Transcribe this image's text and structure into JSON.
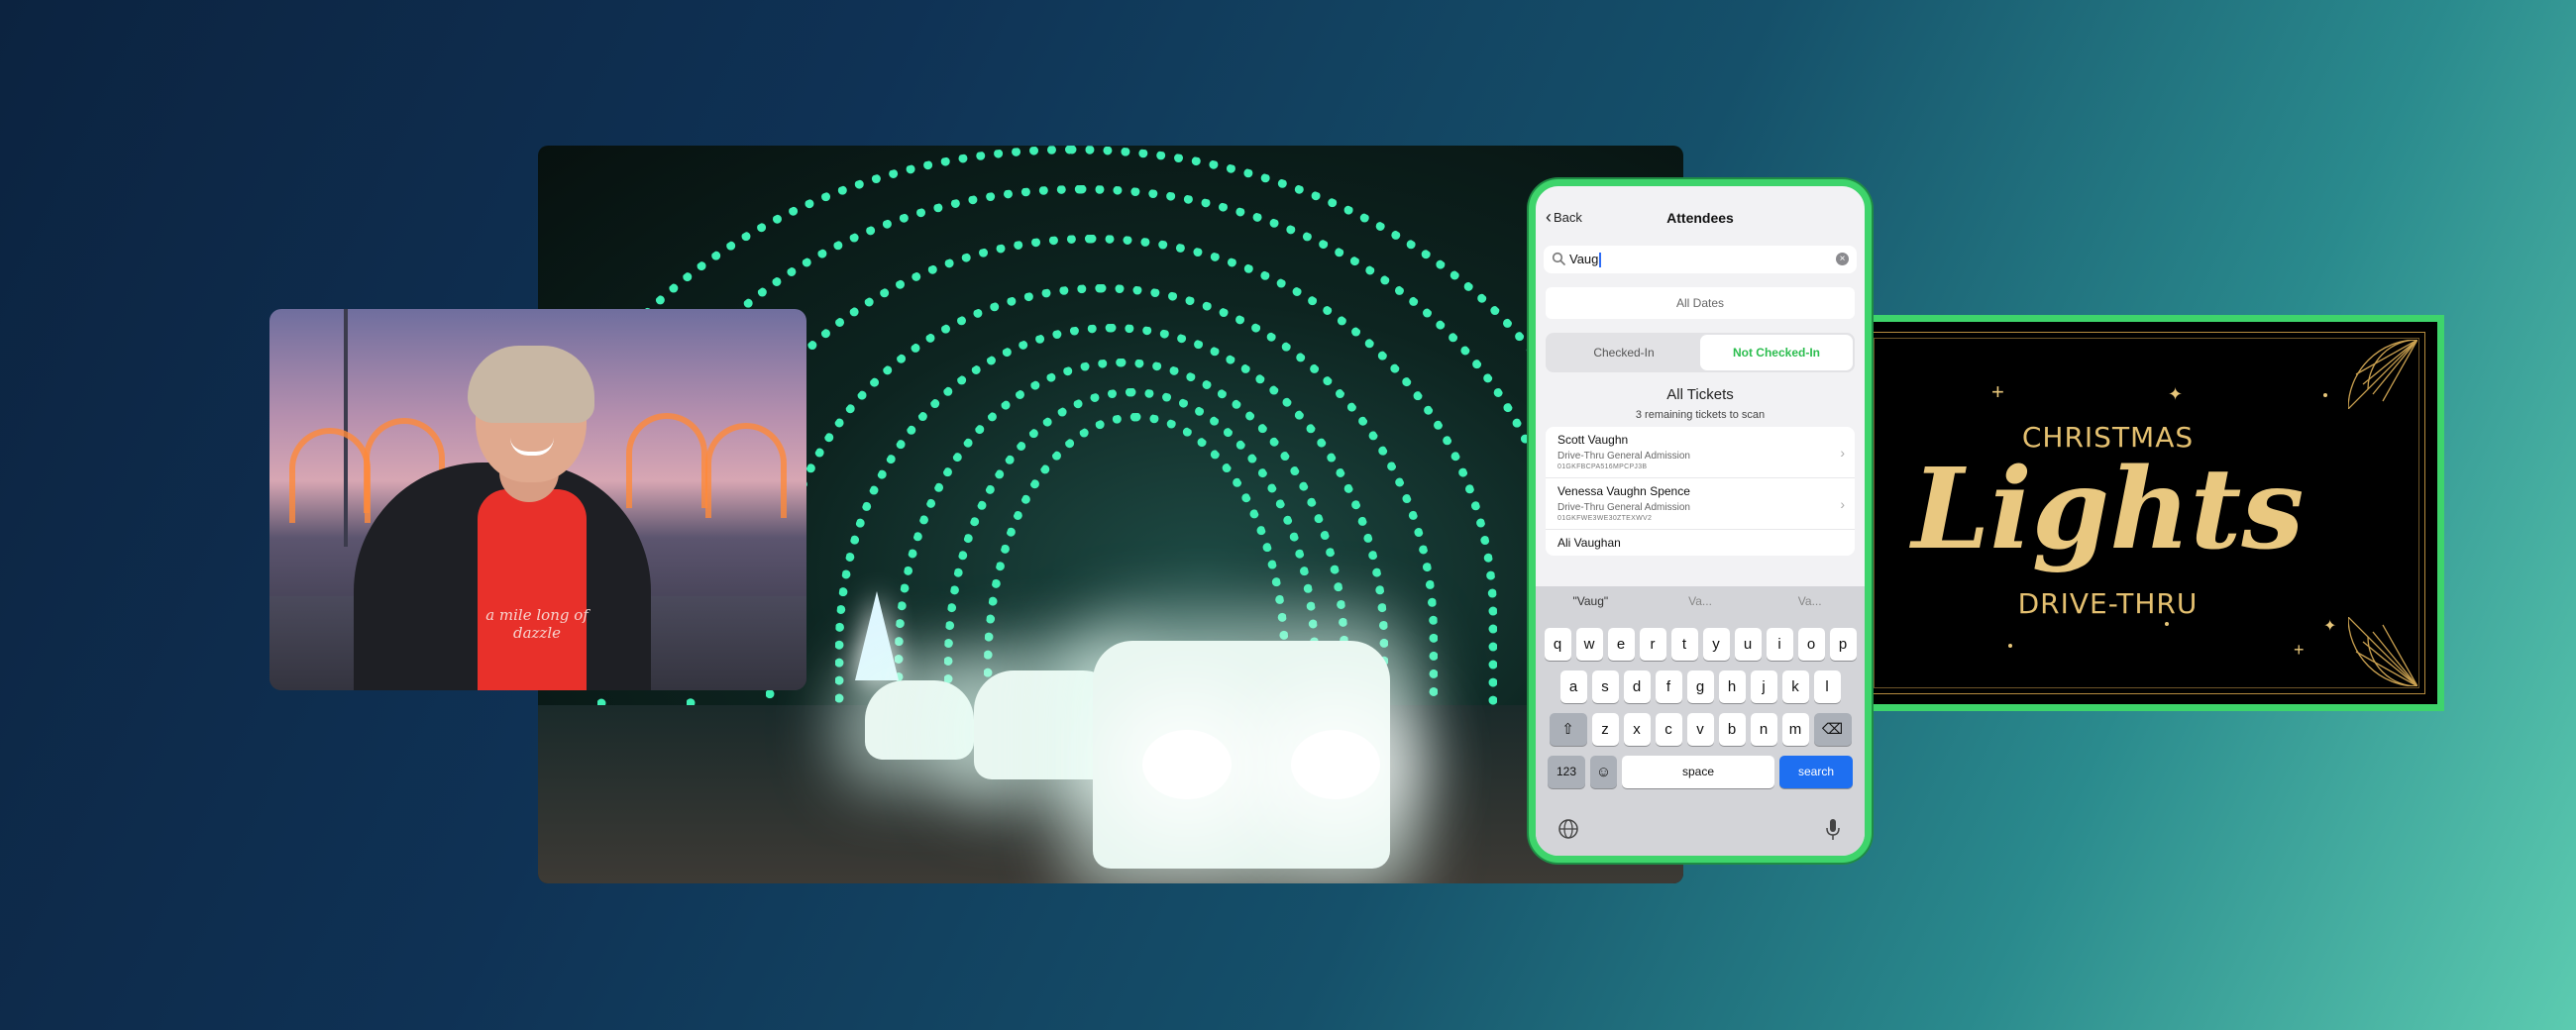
{
  "photo_left": {
    "shirt_text": "a mile long of dazzle"
  },
  "phone": {
    "nav": {
      "back_label": "Back",
      "title": "Attendees"
    },
    "search": {
      "value": "Vaug"
    },
    "dates_filter": "All Dates",
    "segments": {
      "checked_in": "Checked-In",
      "not_checked_in": "Not Checked-In"
    },
    "tickets_title": "All Tickets",
    "tickets_subtitle": "3 remaining tickets to scan",
    "attendees": [
      {
        "name": "Scott Vaughn",
        "type": "Drive-Thru General Admission",
        "code": "01GKFBCPA516MPCPJ3B"
      },
      {
        "name": "Venessa Vaughn Spence",
        "type": "Drive-Thru General Admission",
        "code": "01GKFWE3WE30ZTEXWV2"
      },
      {
        "name": "Ali Vaughan",
        "type": "",
        "code": ""
      }
    ],
    "keyboard": {
      "suggestions": [
        "\"Vaug\"",
        "Va...",
        "Va..."
      ],
      "row1": [
        "q",
        "w",
        "e",
        "r",
        "t",
        "y",
        "u",
        "i",
        "o",
        "p"
      ],
      "row2": [
        "a",
        "s",
        "d",
        "f",
        "g",
        "h",
        "j",
        "k",
        "l"
      ],
      "row3": [
        "z",
        "x",
        "c",
        "v",
        "b",
        "n",
        "m"
      ],
      "num_label": "123",
      "space_label": "space",
      "search_label": "search"
    }
  },
  "banner": {
    "line1": "CHRISTMAS",
    "line2": "Lights",
    "line3": "DRIVE-THRU"
  }
}
